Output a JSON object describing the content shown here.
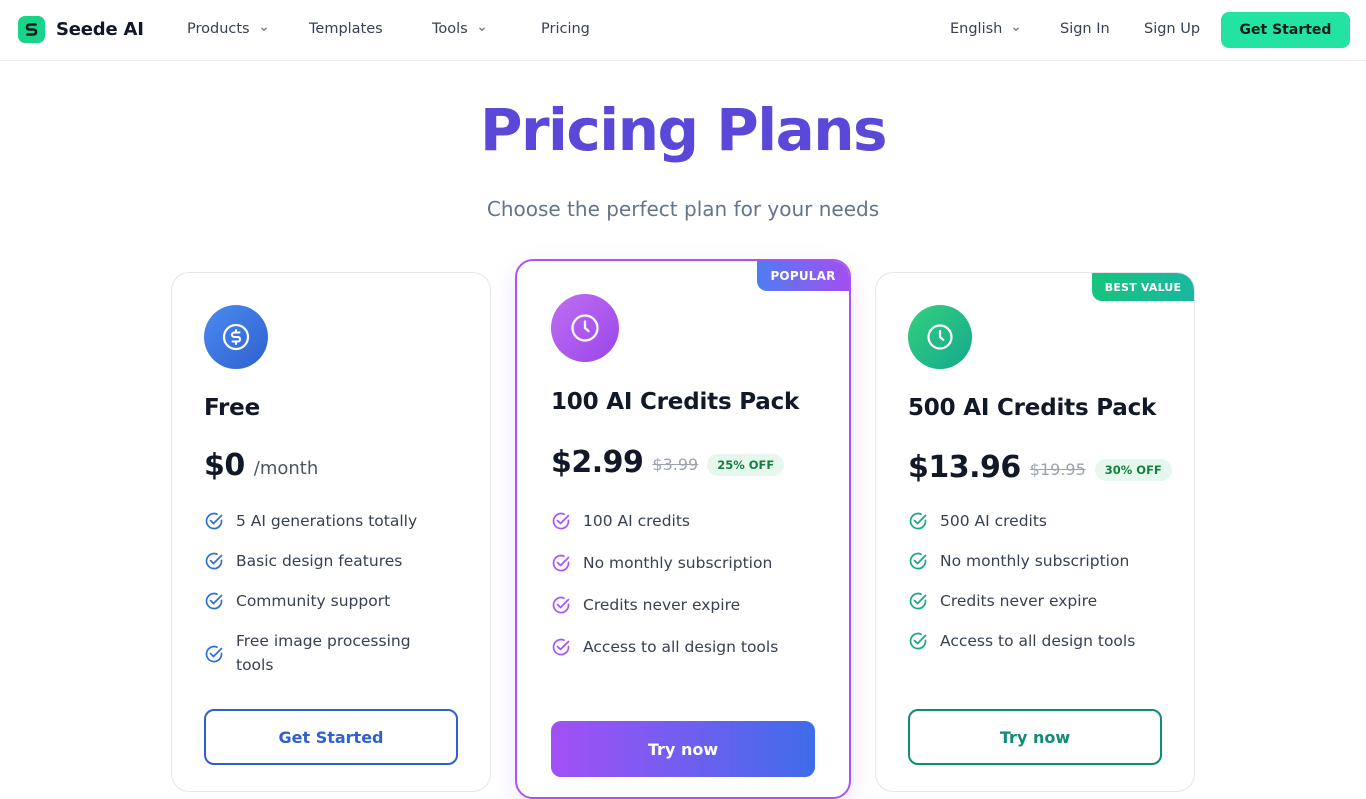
{
  "nav": {
    "brand": "Seede AI",
    "links": {
      "products": "Products",
      "templates": "Templates",
      "tools": "Tools",
      "pricing": "Pricing"
    },
    "language": "English",
    "sign_in": "Sign In",
    "sign_up": "Sign Up",
    "get_started": "Get Started"
  },
  "hero": {
    "title": "Pricing Plans",
    "subtitle": "Choose the perfect plan for your needs"
  },
  "plans": {
    "free": {
      "name": "Free",
      "price": "$0",
      "period": "/month",
      "features": [
        "5 AI generations totally",
        "Basic design features",
        "Community support",
        "Free image processing tools"
      ],
      "cta": "Get Started",
      "icon": "dollar-icon",
      "accent": "#2f5fd0"
    },
    "pack100": {
      "badge": "POPULAR",
      "name": "100 AI Credits Pack",
      "price": "$2.99",
      "old_price": "$3.99",
      "discount": "25% OFF",
      "features": [
        "100 AI credits",
        "No monthly subscription",
        "Credits never expire",
        "Access to all design tools"
      ],
      "cta": "Try now",
      "icon": "clock-icon",
      "accent": "#a855f7"
    },
    "pack500": {
      "badge": "BEST VALUE",
      "name": "500 AI Credits Pack",
      "price": "$13.96",
      "old_price": "$19.95",
      "discount": "30% OFF",
      "features": [
        "500 AI credits",
        "No monthly subscription",
        "Credits never expire",
        "Access to all design tools"
      ],
      "cta": "Try now",
      "icon": "clock-icon",
      "accent": "#0f8b76"
    }
  },
  "colors": {
    "brand_green": "#22e3a2",
    "title_purple": "#5a48d9",
    "discount_green": "#15803d"
  }
}
